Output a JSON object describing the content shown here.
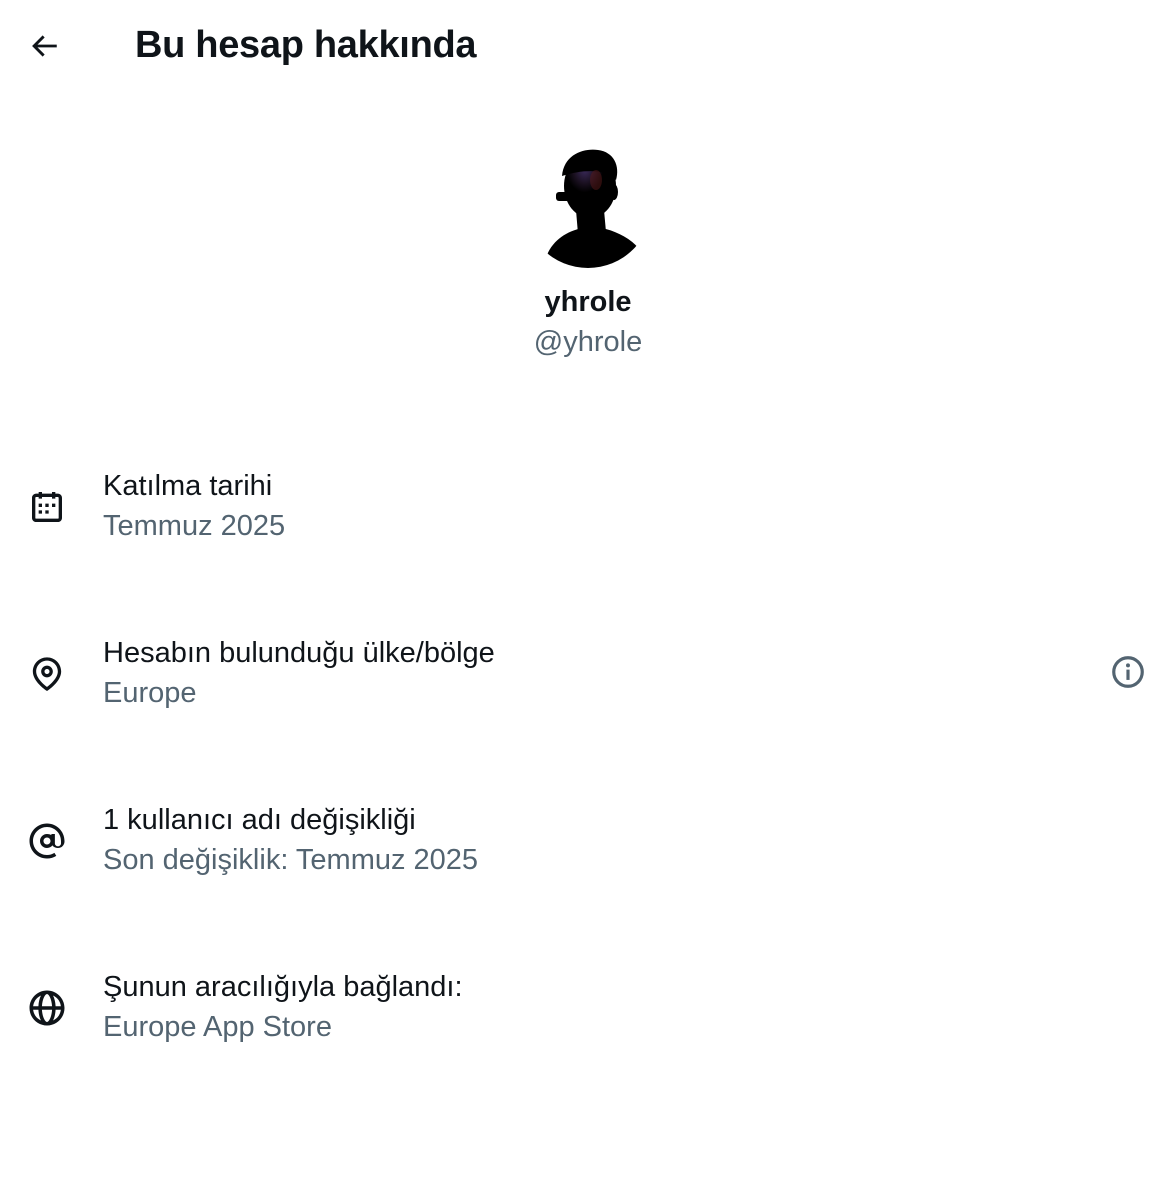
{
  "header": {
    "back_icon": "arrow-left-icon",
    "title": "Bu hesap hakkında"
  },
  "profile": {
    "display_name": "yhrole",
    "handle": "@yhrole"
  },
  "info": [
    {
      "icon": "calendar-icon",
      "title": "Katılma tarihi",
      "subtitle": "Temmuz 2025"
    },
    {
      "icon": "location-pin-icon",
      "title": "Hesabın bulunduğu ülke/bölge",
      "subtitle": "Europe",
      "action_icon": "info-circle-icon"
    },
    {
      "icon": "at-sign-icon",
      "title": "1 kullanıcı adı değişikliği",
      "subtitle": "Son değişiklik: Temmuz 2025"
    },
    {
      "icon": "globe-icon",
      "title": "Şunun aracılığıyla bağlandı:",
      "subtitle": "Europe App Store"
    }
  ],
  "colors": {
    "text_primary": "#0f1419",
    "text_secondary": "#536471",
    "background": "#ffffff"
  }
}
